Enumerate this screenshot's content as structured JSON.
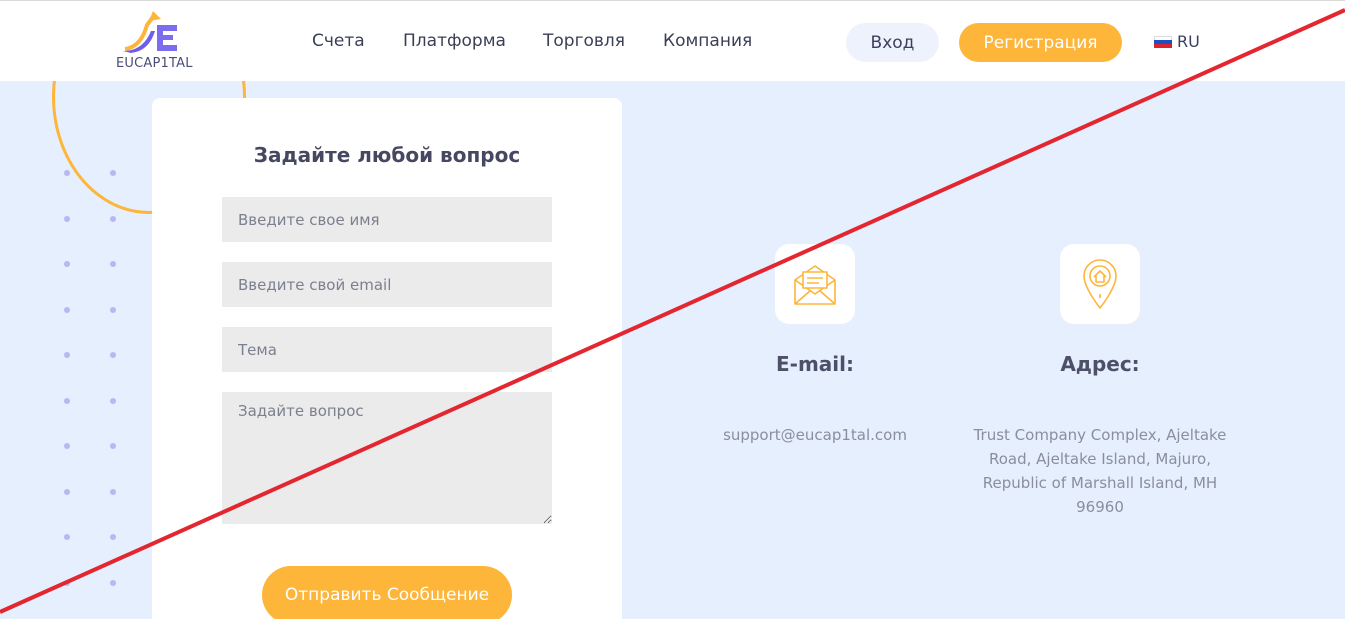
{
  "header": {
    "logo_text": "EUCAP1TAL",
    "nav": [
      "Счета",
      "Платформа",
      "Торговля",
      "Компания"
    ],
    "login_label": "Вход",
    "register_label": "Регистрация",
    "lang_label": "RU"
  },
  "form": {
    "title": "Задайте любой вопрос",
    "name_placeholder": "Введите свое имя",
    "email_placeholder": "Введите свой email",
    "subject_placeholder": "Тема",
    "message_placeholder": "Задайте вопрос",
    "submit_label": "Отправить Сообщение"
  },
  "contacts": {
    "email_title": "E-mail:",
    "email_value": "support@eucap1tal.com",
    "email_icon": "envelope-icon",
    "address_title": "Адрес:",
    "address_lines": [
      "Trust Company Complex, Ajeltake",
      "Road, Ajeltake Island, Majuro,",
      "Republic of Marshall Island, MH",
      "96960"
    ],
    "address_icon": "map-pin-icon"
  },
  "colors": {
    "accent": "#fdb53a",
    "background": "#e5effd",
    "strike": "#e3262f"
  }
}
